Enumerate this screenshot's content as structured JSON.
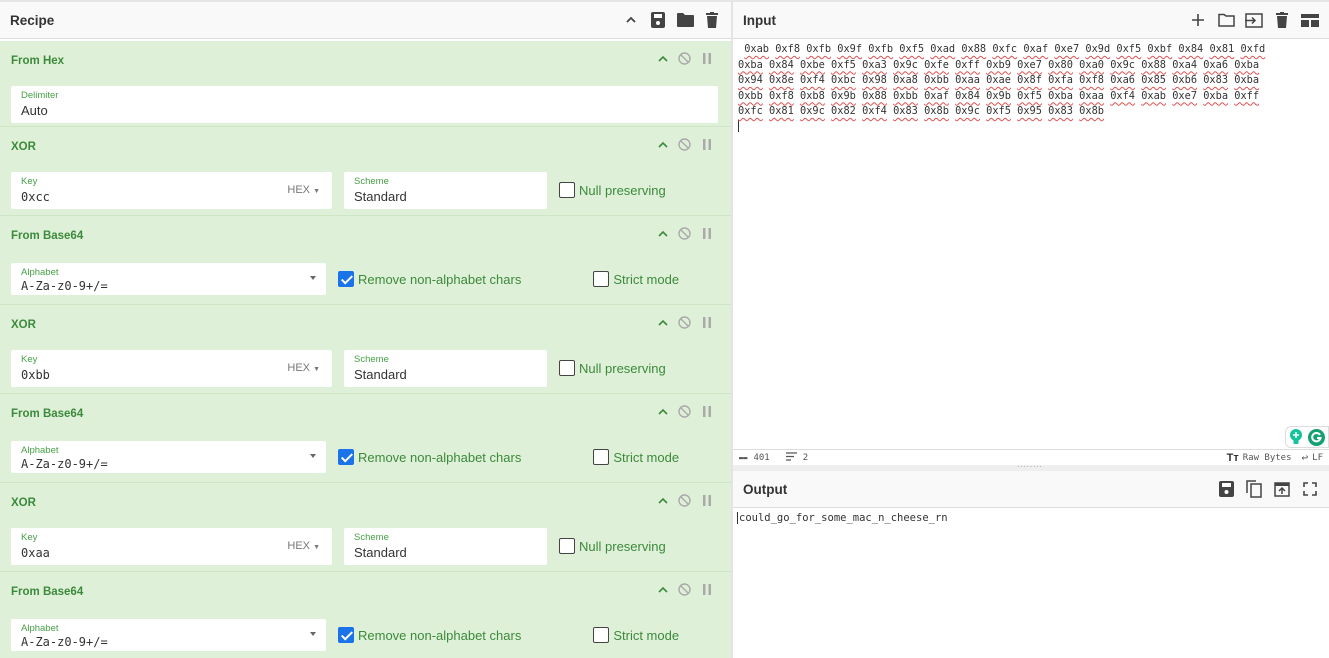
{
  "recipe": {
    "title": "Recipe",
    "operations": [
      {
        "name": "From Hex",
        "type": "fromhex",
        "delimiter_label": "Delimiter",
        "delimiter_value": "Auto"
      },
      {
        "name": "XOR",
        "type": "xor",
        "key_label": "Key",
        "key_value": "0xcc",
        "key_format": "HEX",
        "scheme_label": "Scheme",
        "scheme_value": "Standard",
        "null_label": "Null preserving",
        "null_checked": false
      },
      {
        "name": "From Base64",
        "type": "b64",
        "alphabet_label": "Alphabet",
        "alphabet_value": "A-Za-z0-9+/=",
        "remove_label": "Remove non-alphabet chars",
        "remove_checked": true,
        "strict_label": "Strict mode",
        "strict_checked": false
      },
      {
        "name": "XOR",
        "type": "xor",
        "key_label": "Key",
        "key_value": "0xbb",
        "key_format": "HEX",
        "scheme_label": "Scheme",
        "scheme_value": "Standard",
        "null_label": "Null preserving",
        "null_checked": false
      },
      {
        "name": "From Base64",
        "type": "b64",
        "alphabet_label": "Alphabet",
        "alphabet_value": "A-Za-z0-9+/=",
        "remove_label": "Remove non-alphabet chars",
        "remove_checked": true,
        "strict_label": "Strict mode",
        "strict_checked": false
      },
      {
        "name": "XOR",
        "type": "xor",
        "key_label": "Key",
        "key_value": "0xaa",
        "key_format": "HEX",
        "scheme_label": "Scheme",
        "scheme_value": "Standard",
        "null_label": "Null preserving",
        "null_checked": false
      },
      {
        "name": "From Base64",
        "type": "b64",
        "alphabet_label": "Alphabet",
        "alphabet_value": "A-Za-z0-9+/=",
        "remove_label": "Remove non-alphabet chars",
        "remove_checked": true,
        "strict_label": "Strict mode",
        "strict_checked": false
      }
    ]
  },
  "input": {
    "title": "Input",
    "lines": [
      " 0xab 0xf8 0xfb 0x9f 0xfb 0xf5 0xad 0x88 0xfc 0xaf 0xe7 0x9d 0xf5 0xbf 0x84 0x81 0xfd",
      "0xba 0x84 0xbe 0xf5 0xa3 0x9c 0xfe 0xff 0xb9 0xe7 0x80 0xa0 0x9c 0x88 0xa4 0xa6 0xba",
      "0x94 0x8e 0xf4 0xbc 0x98 0xa8 0xbb 0xaa 0xae 0x8f 0xfa 0xf8 0xa6 0x85 0xb6 0x83 0xba",
      "0xbb 0xf8 0xb8 0x9b 0x88 0xbb 0xaf 0x84 0x9b 0xf5 0xba 0xaa 0xf4 0xab 0xe7 0xba 0xff",
      "0xfc 0x81 0x9c 0x82 0xf4 0x83 0x8b 0x9c 0xf5 0x95 0x83 0x8b"
    ],
    "status": {
      "length": "401",
      "lines": "2",
      "encoding": "Raw Bytes",
      "eol": "LF"
    }
  },
  "output": {
    "title": "Output",
    "text": "could_go_for_some_mac_n_cheese_rn"
  }
}
